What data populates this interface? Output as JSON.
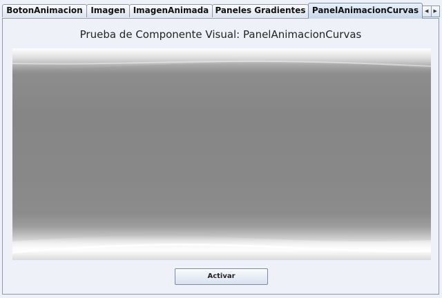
{
  "tabs": [
    {
      "label": "BotonAnimacion",
      "selected": false
    },
    {
      "label": "Imagen",
      "selected": false
    },
    {
      "label": "ImagenAnimada",
      "selected": false
    },
    {
      "label": "Paneles Gradientes",
      "selected": false
    },
    {
      "label": "PanelAnimacionCurvas",
      "selected": true
    }
  ],
  "tab_scroll": {
    "left": "◀",
    "right": "▶"
  },
  "page": {
    "title": "Prueba de Componente Visual: PanelAnimacionCurvas"
  },
  "activate_button": {
    "label": "Activar"
  }
}
